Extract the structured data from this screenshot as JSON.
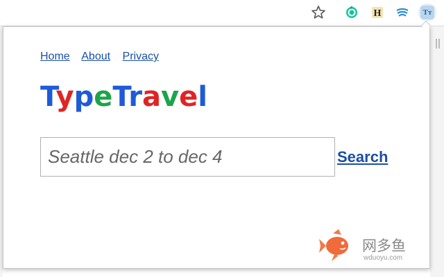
{
  "toolbar": {
    "icons": [
      "star-icon",
      "grammarly-extension-icon",
      "honey-extension-icon",
      "streak-extension-icon",
      "typetravel-extension-icon"
    ],
    "typetravel_icon_label": "Tт"
  },
  "nav": {
    "links": [
      {
        "label": "Home"
      },
      {
        "label": "About"
      },
      {
        "label": "Privacy"
      }
    ]
  },
  "logo": {
    "letters": [
      {
        "char": "T",
        "color": "#1e5bd6"
      },
      {
        "char": "y",
        "color": "#e02424"
      },
      {
        "char": "p",
        "color": "#1e5bd6"
      },
      {
        "char": "e",
        "color": "#1ea34a"
      },
      {
        "char": "T",
        "color": "#1e5bd6"
      },
      {
        "char": "r",
        "color": "#1e5bd6"
      },
      {
        "char": "a",
        "color": "#e02424"
      },
      {
        "char": "v",
        "color": "#1ea34a"
      },
      {
        "char": "e",
        "color": "#e02424"
      },
      {
        "char": "l",
        "color": "#1e5bd6"
      }
    ]
  },
  "search": {
    "placeholder": "Seattle dec 2 to dec 4",
    "value": "",
    "button_label": "Search"
  },
  "watermark": {
    "text": "网多鱼",
    "url": "wduoyu.com"
  },
  "colors": {
    "link": "#1a4fa3",
    "border": "#c8c8c8"
  }
}
